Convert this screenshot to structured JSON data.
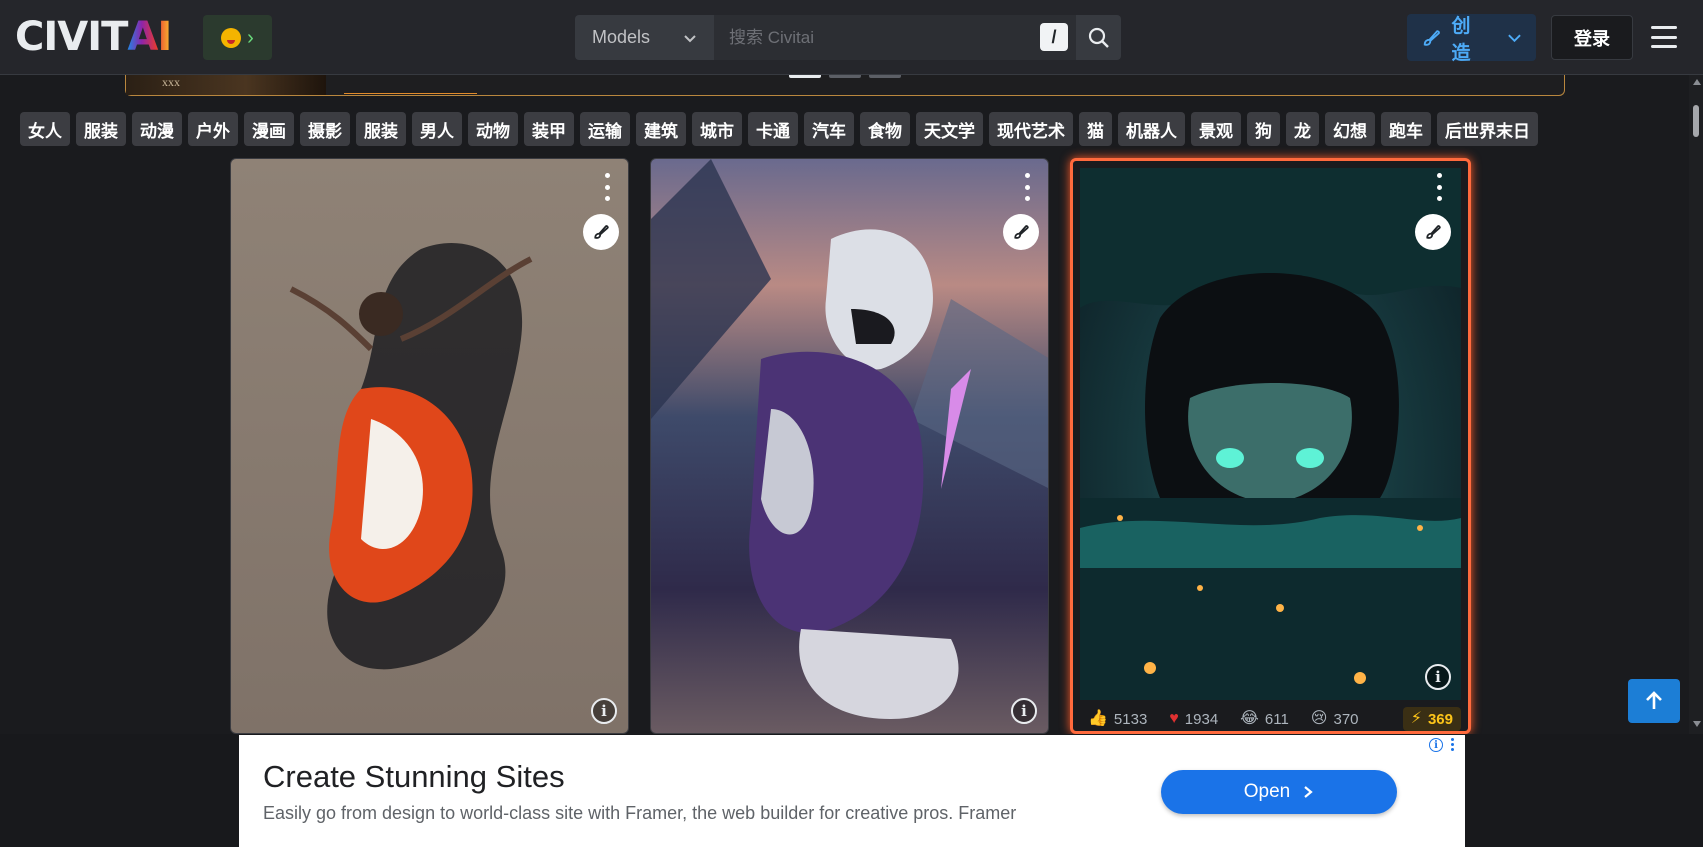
{
  "header": {
    "logo_civ": "CIVIT",
    "logo_ai": "AI",
    "search_category": "Models",
    "search_placeholder": "搜索 Civitai",
    "search_shortcut": "/",
    "create_label": "创造",
    "login_label": "登录"
  },
  "banner": {
    "thumb_text": "xxx"
  },
  "categories": [
    "女人",
    "服装",
    "动漫",
    "户外",
    "漫画",
    "摄影",
    "服装",
    "男人",
    "动物",
    "装甲",
    "运输",
    "建筑",
    "城市",
    "卡通",
    "汽车",
    "食物",
    "天文学",
    "现代艺术",
    "猫",
    "机器人",
    "景观",
    "狗",
    "龙",
    "幻想",
    "跑车",
    "后世界末日"
  ],
  "cards": [
    {
      "info_glyph": "i"
    },
    {
      "info_glyph": "i"
    },
    {
      "info_glyph": "i",
      "stats": {
        "likes": "5133",
        "hearts": "1934",
        "laugh": "611",
        "cry": "370",
        "buzz": "369"
      }
    }
  ],
  "ad": {
    "title": "Create Stunning Sites",
    "subtitle": "Easily go from design to world-class site with Framer, the web builder for creative pros. Framer",
    "open_label": "Open",
    "info_glyph": "i"
  },
  "colors": {
    "accent_blue": "#1c7ed6",
    "highlight_orange": "#ff6a3d",
    "buzz_yellow": "#fcc419"
  }
}
